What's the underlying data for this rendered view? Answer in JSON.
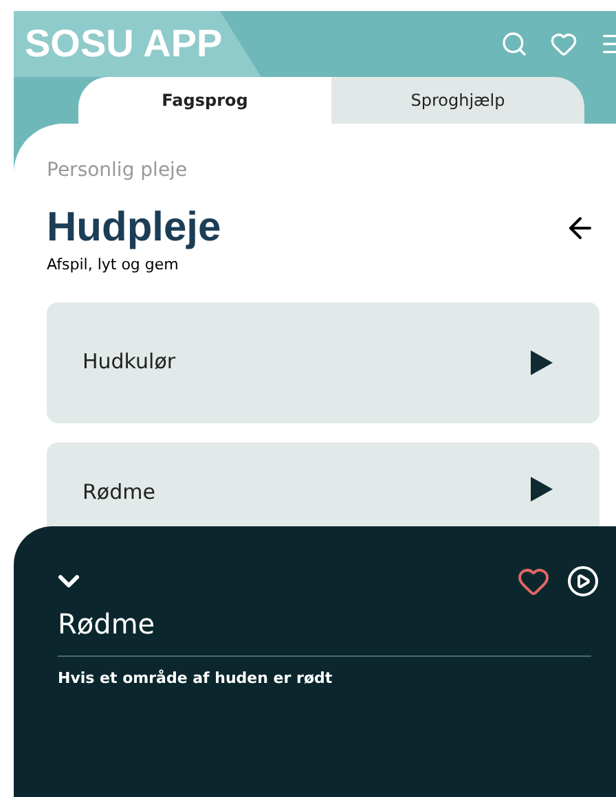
{
  "header": {
    "title": "SOSU APP"
  },
  "tabs": [
    {
      "label": "Fagsprog",
      "selected": true
    },
    {
      "label": "Sproghjælp",
      "selected": false
    }
  ],
  "breadcrumb": "Personlig pleje",
  "page": {
    "title": "Hudpleje",
    "subtitle": "Afspil, lyt og gem"
  },
  "terms": [
    {
      "label": "Hudkulør"
    },
    {
      "label": "Rødme"
    }
  ],
  "player": {
    "title": "Rødme",
    "description": "Hvis et område af huden er rødt"
  }
}
